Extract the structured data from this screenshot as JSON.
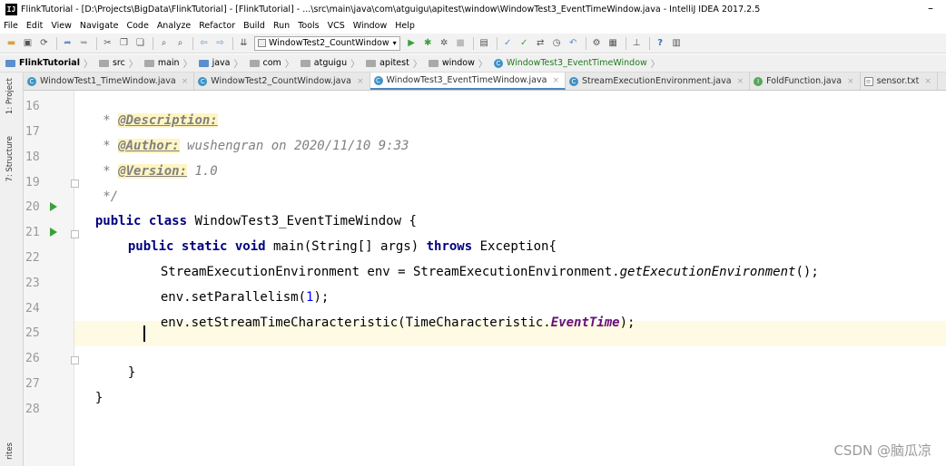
{
  "window": {
    "title": "FlinkTutorial - [D:\\Projects\\BigData\\FlinkTutorial] - [FlinkTutorial] - ...\\src\\main\\java\\com\\atguigu\\apitest\\window\\WindowTest3_EventTimeWindow.java - IntelliJ IDEA 2017.2.5",
    "minimize_label": "–"
  },
  "menu": [
    "File",
    "Edit",
    "View",
    "Navigate",
    "Code",
    "Analyze",
    "Refactor",
    "Build",
    "Run",
    "Tools",
    "VCS",
    "Window",
    "Help"
  ],
  "toolbar": {
    "run_config": "WindowTest2_CountWindow"
  },
  "breadcrumbs": [
    "FlinkTutorial",
    "src",
    "main",
    "java",
    "com",
    "atguigu",
    "apitest",
    "window",
    "WindowTest3_EventTimeWindow"
  ],
  "tabs": [
    {
      "label": "WindowTest1_TimeWindow.java",
      "icon": "C",
      "active": false
    },
    {
      "label": "WindowTest2_CountWindow.java",
      "icon": "C",
      "active": false
    },
    {
      "label": "WindowTest3_EventTimeWindow.java",
      "icon": "C",
      "active": true
    },
    {
      "label": "StreamExecutionEnvironment.java",
      "icon": "C",
      "active": false
    },
    {
      "label": "FoldFunction.java",
      "icon": "I",
      "active": false
    },
    {
      "label": "sensor.txt",
      "icon": "doc",
      "active": false
    }
  ],
  "sidebar": {
    "project_tab": "1: Project",
    "structure_tab": "7: Structure",
    "favorites_tab": "rites"
  },
  "editor": {
    "line_numbers": [
      "16",
      "17",
      "18",
      "19",
      "20",
      "21",
      "22",
      "23",
      "24",
      "25",
      "26",
      "27",
      "28"
    ],
    "lines": {
      "l16_prefix": " * ",
      "l16_tag": "@Description:",
      "l17_prefix": " * ",
      "l17_tag": "@Author:",
      "l17_val": " wushengran on 2020/11/10 9:33",
      "l18_prefix": " * ",
      "l18_tag": "@Version:",
      "l18_val": " 1.0",
      "l19": " */",
      "l20_kw": "public class",
      "l20_rest": " WindowTest3_EventTimeWindow {",
      "l21_kw1": "public static void",
      "l21_mid": " main(String[] args) ",
      "l21_kw2": "throws",
      "l21_rest": " Exception{",
      "l22_a": "StreamExecutionEnvironment env = StreamExecutionEnvironment.",
      "l22_b": "getExecutionEnvironment",
      "l22_c": "();",
      "l23_a": "env.setParallelism(",
      "l23_num": "1",
      "l23_c": ");",
      "l24_a": "env.setStreamTimeCharacteristic(TimeCharacteristic.",
      "l24_field": "EventTime",
      "l24_c": ");",
      "l26": "}",
      "l27": "}"
    }
  },
  "watermark": "CSDN @脑瓜凉",
  "colors": {
    "keyword": "#000080",
    "doc_comment": "#808080",
    "number": "#0000ff",
    "static_field": "#660e7a",
    "current_line": "#fffae3",
    "run_marker": "#3a9f3a"
  }
}
